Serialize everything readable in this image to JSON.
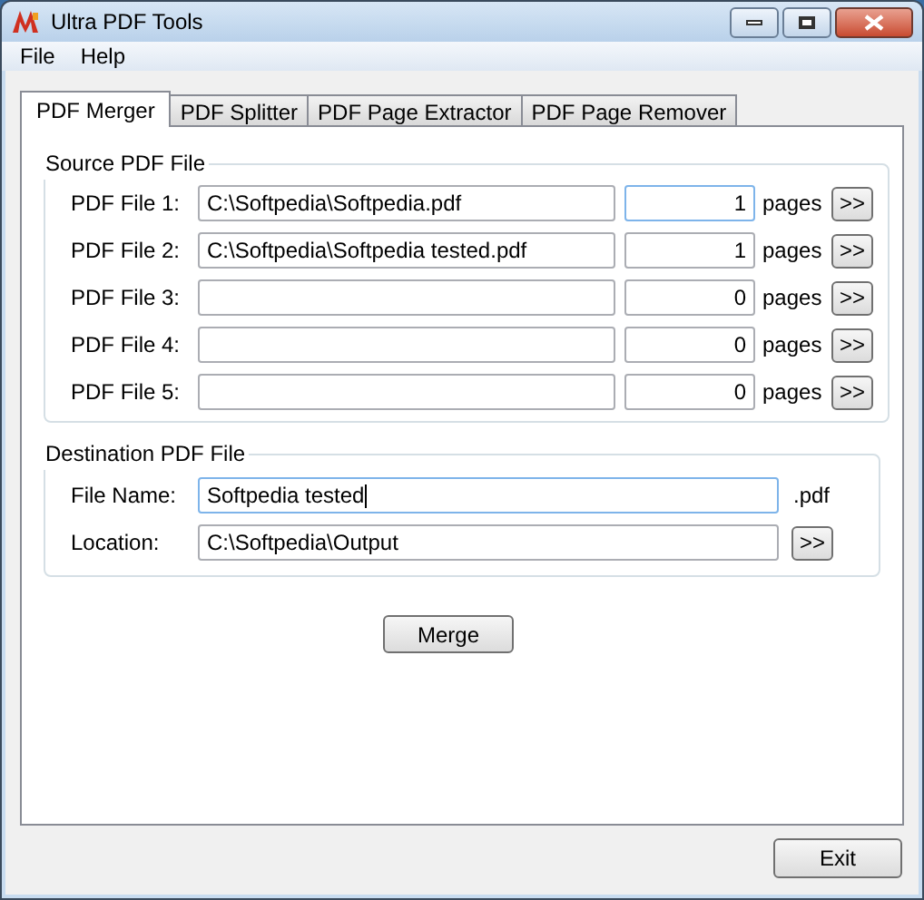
{
  "window": {
    "title": "Ultra PDF Tools"
  },
  "menu": [
    "File",
    "Help"
  ],
  "tabs": [
    {
      "label": "PDF Merger",
      "selected": true
    },
    {
      "label": "PDF Splitter",
      "selected": false
    },
    {
      "label": "PDF Page Extractor",
      "selected": false
    },
    {
      "label": "PDF Page Remover",
      "selected": false
    }
  ],
  "source": {
    "title": "Source PDF File",
    "rows": [
      {
        "label": "PDF File 1:",
        "path": "C:\\Softpedia\\Softpedia.pdf",
        "pages": "1",
        "unit": "pages",
        "button": ">>",
        "focused": true
      },
      {
        "label": "PDF File 2:",
        "path": "C:\\Softpedia\\Softpedia tested.pdf",
        "pages": "1",
        "unit": "pages",
        "button": ">>",
        "focused": false
      },
      {
        "label": "PDF File 3:",
        "pages": "0",
        "unit": "pages",
        "button": ">>",
        "focused": false
      },
      {
        "label": "PDF File 4:",
        "pages": "0",
        "unit": "pages",
        "button": ">>",
        "focused": false
      },
      {
        "label": "PDF File 5:",
        "pages": "0",
        "unit": "pages",
        "button": ">>",
        "focused": false
      }
    ]
  },
  "destination": {
    "title": "Destination PDF File",
    "file_name_label": "File Name:",
    "file_name": "Softpedia tested",
    "extension": ".pdf",
    "location_label": "Location:",
    "location": "C:\\Softpedia\\Output",
    "browse_button": ">>"
  },
  "merge_button": "Merge",
  "exit_button": "Exit"
}
